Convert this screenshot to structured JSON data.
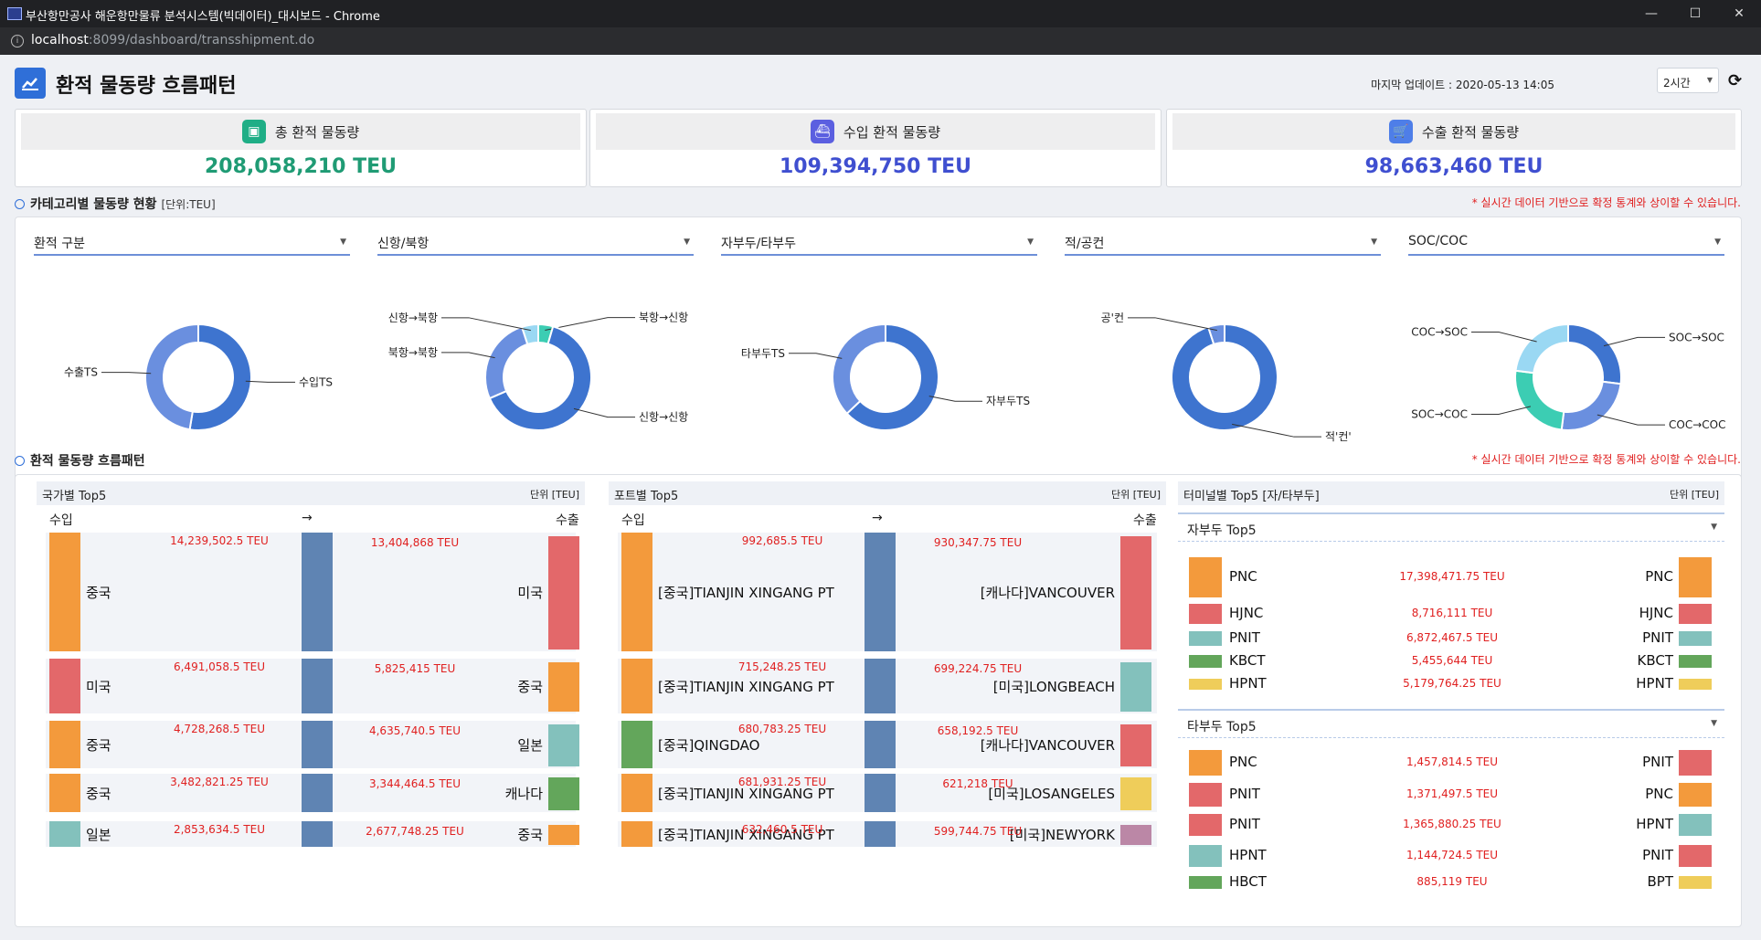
{
  "window": {
    "title": "부산항만공사 해운항만물류 분석시스템(빅데이터)_대시보드 - Chrome",
    "url_host": "localhost",
    "url_rest": ":8099/dashboard/transshipment.do"
  },
  "header": {
    "title": "환적 물동량 흐름패턴",
    "last_update_label": "마지막 업데이트 : ",
    "last_update_value": "2020-05-13 14:05",
    "period": "2시간"
  },
  "kpis": [
    {
      "label": "총 환적 물동량",
      "value": "208,058,210 TEU",
      "color": "#1f9b74"
    },
    {
      "label": "수입 환적 물동량",
      "value": "109,394,750 TEU",
      "color": "#3f4fd0"
    },
    {
      "label": "수출 환적 물동량",
      "value": "98,663,460 TEU",
      "color": "#3f4fd0"
    }
  ],
  "category_section": {
    "title": "카테고리별 물동량 현황",
    "unit": "[단위:TEU]",
    "notice": "* 실시간 데이터 기반으로 확정 통계와 상이할 수 있습니다.",
    "selects": [
      "환적 구분",
      "신항/북항",
      "자부두/타부두",
      "적/공컨",
      "SOC/COC"
    ]
  },
  "chart_data": [
    {
      "type": "pie",
      "categories": [
        "수입TS",
        "수출TS"
      ],
      "values": [
        52.6,
        47.4
      ],
      "colors": [
        "#3e74cf",
        "#6a8fdf"
      ]
    },
    {
      "type": "pie",
      "categories": [
        "북항→신항",
        "신항→신항",
        "북항→북항",
        "신항→북항"
      ],
      "values": [
        4.5,
        64,
        26.5,
        5
      ],
      "colors": [
        "#3ccdb3",
        "#3e74cf",
        "#6a8fdf",
        "#9ad8f3"
      ]
    },
    {
      "type": "pie",
      "categories": [
        "자부두TS",
        "타부두TS"
      ],
      "values": [
        63,
        37
      ],
      "colors": [
        "#3e74cf",
        "#6a8fdf"
      ]
    },
    {
      "type": "pie",
      "categories": [
        "적'컨'",
        "공'컨"
      ],
      "values": [
        95,
        5
      ],
      "colors": [
        "#3e74cf",
        "#6a8fdf"
      ]
    },
    {
      "type": "pie",
      "categories": [
        "SOC→SOC",
        "COC→COC",
        "SOC→COC",
        "COC→SOC"
      ],
      "values": [
        27,
        25,
        25,
        23
      ],
      "colors": [
        "#3e74cf",
        "#6a8fdf",
        "#3ccdb3",
        "#9ad8f3"
      ]
    }
  ],
  "flow_section": {
    "title": "환적 물동량 흐름패턴",
    "notice": "* 실시간 데이터 기반으로 확정 통계와 상이할 수 있습니다."
  },
  "country_top5": {
    "title": "국가별 Top5",
    "unit": "단위 [TEU]",
    "import_label": "수입",
    "arrow": "→",
    "export_label": "수출",
    "rows": [
      {
        "in_name": "중국",
        "in_teu": "14,239,502.5 TEU",
        "in_color": "#f39a3c",
        "out_name": "미국",
        "out_teu": "13,404,868 TEU",
        "out_color": "#e3686a"
      },
      {
        "in_name": "미국",
        "in_teu": "6,491,058.5 TEU",
        "in_color": "#e3686a",
        "out_name": "중국",
        "out_teu": "5,825,415 TEU",
        "out_color": "#f39a3c"
      },
      {
        "in_name": "중국",
        "in_teu": "4,728,268.5 TEU",
        "in_color": "#f39a3c",
        "out_name": "일본",
        "out_teu": "4,635,740.5 TEU",
        "out_color": "#83c1bc"
      },
      {
        "in_name": "중국",
        "in_teu": "3,482,821.25 TEU",
        "in_color": "#f39a3c",
        "out_name": "캐나다",
        "out_teu": "3,344,464.5 TEU",
        "out_color": "#63a65b"
      },
      {
        "in_name": "일본",
        "in_teu": "2,853,634.5 TEU",
        "in_color": "#83c1bc",
        "out_name": "중국",
        "out_teu": "2,677,748.25 TEU",
        "out_color": "#f39a3c"
      }
    ]
  },
  "port_top5": {
    "title": "포트별 Top5",
    "unit": "단위 [TEU]",
    "import_label": "수입",
    "arrow": "→",
    "export_label": "수출",
    "rows": [
      {
        "in_name": "[중국]TIANJIN XINGANG PT",
        "in_teu": "992,685.5 TEU",
        "in_color": "#f39a3c",
        "out_name": "[캐나다]VANCOUVER",
        "out_teu": "930,347.75 TEU",
        "out_color": "#e3686a"
      },
      {
        "in_name": "[중국]TIANJIN XINGANG PT",
        "in_teu": "715,248.25 TEU",
        "in_color": "#f39a3c",
        "out_name": "[미국]LONGBEACH",
        "out_teu": "699,224.75 TEU",
        "out_color": "#83c1bc"
      },
      {
        "in_name": "[중국]QINGDAO",
        "in_teu": "680,783.25 TEU",
        "in_color": "#63a65b",
        "out_name": "[캐나다]VANCOUVER",
        "out_teu": "658,192.5 TEU",
        "out_color": "#e3686a"
      },
      {
        "in_name": "[중국]TIANJIN XINGANG PT",
        "in_teu": "681,931.25 TEU",
        "in_color": "#f39a3c",
        "out_name": "[미국]LOSANGELES",
        "out_teu": "621,218 TEU",
        "out_color": "#efcd5a"
      },
      {
        "in_name": "[중국]TIANJIN XINGANG PT",
        "in_teu": "632,460.5 TEU",
        "in_color": "#f39a3c",
        "out_name": "[미국]NEWYORK",
        "out_teu": "599,744.75 TEU",
        "out_color": "#bb87a6"
      }
    ]
  },
  "terminal_top5": {
    "title": "터미널별 Top5 [자/타부두]",
    "unit": "단위 [TEU]",
    "own_label": "자부두 Top5",
    "other_label": "타부두 Top5",
    "own_rows": [
      {
        "in_name": "PNC",
        "teu": "17,398,471.75 TEU",
        "out_name": "PNC",
        "in_color": "#f39a3c",
        "out_color": "#f39a3c"
      },
      {
        "in_name": "HJNC",
        "teu": "8,716,111 TEU",
        "out_name": "HJNC",
        "in_color": "#e3686a",
        "out_color": "#e3686a"
      },
      {
        "in_name": "PNIT",
        "teu": "6,872,467.5 TEU",
        "out_name": "PNIT",
        "in_color": "#83c1bc",
        "out_color": "#83c1bc"
      },
      {
        "in_name": "KBCT",
        "teu": "5,455,644 TEU",
        "out_name": "KBCT",
        "in_color": "#63a65b",
        "out_color": "#63a65b"
      },
      {
        "in_name": "HPNT",
        "teu": "5,179,764.25 TEU",
        "out_name": "HPNT",
        "in_color": "#efcd5a",
        "out_color": "#efcd5a"
      }
    ],
    "other_rows": [
      {
        "in_name": "PNC",
        "teu": "1,457,814.5 TEU",
        "out_name": "PNIT",
        "in_color": "#f39a3c",
        "out_color": "#e3686a"
      },
      {
        "in_name": "PNIT",
        "teu": "1,371,497.5 TEU",
        "out_name": "PNC",
        "in_color": "#e3686a",
        "out_color": "#f39a3c"
      },
      {
        "in_name": "PNIT",
        "teu": "1,365,880.25 TEU",
        "out_name": "HPNT",
        "in_color": "#e3686a",
        "out_color": "#83c1bc"
      },
      {
        "in_name": "HPNT",
        "teu": "1,144,724.5 TEU",
        "out_name": "PNIT",
        "in_color": "#83c1bc",
        "out_color": "#e3686a"
      },
      {
        "in_name": "HBCT",
        "teu": "885,119 TEU",
        "out_name": "BPT",
        "in_color": "#63a65b",
        "out_color": "#efcd5a"
      }
    ]
  }
}
